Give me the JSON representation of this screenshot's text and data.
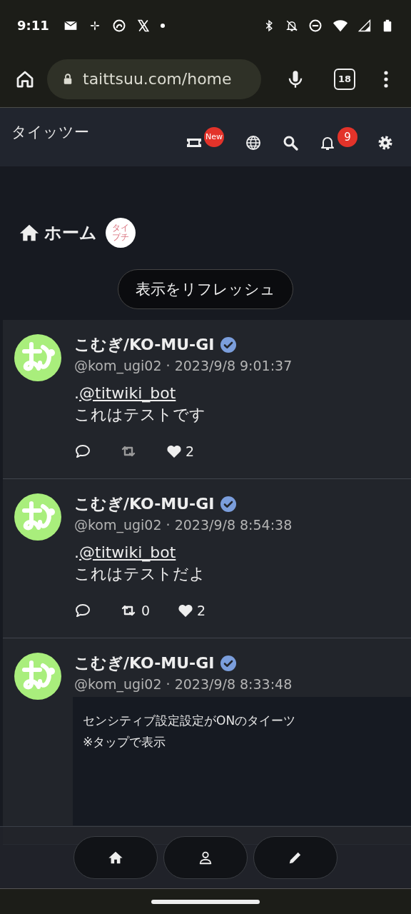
{
  "status_bar": {
    "time": "9:11"
  },
  "browser": {
    "url": "taittsuu.com/home",
    "tab_count": "18"
  },
  "header": {
    "title": "タイッツー",
    "actions": [
      {
        "kind": "ticket",
        "badge": "New"
      },
      {
        "kind": "globe"
      },
      {
        "kind": "search"
      },
      {
        "kind": "bell",
        "badge": "9"
      },
      {
        "kind": "settings"
      }
    ]
  },
  "heading": {
    "title": "ホーム",
    "logo": "タイプチ"
  },
  "refresh_button": "表示をリフレッシュ",
  "posts": [
    {
      "kind": "text",
      "name": "こむぎ/KO-MU-GI",
      "verified": true,
      "meta": "@kom_ugi02 · 2023/9/8 9:01:37",
      "prefix": ".",
      "mention": "@titwiki_bot",
      "text": "これはテストです",
      "retweet": {
        "disabled": true
      },
      "like": {
        "count": "2"
      }
    },
    {
      "kind": "text",
      "name": "こむぎ/KO-MU-GI",
      "verified": true,
      "meta": "@kom_ugi02 · 2023/9/8 8:54:38",
      "prefix": ".",
      "mention": "@titwiki_bot",
      "text": "これはテストだよ",
      "retweet": {
        "disabled": false,
        "count": "0"
      },
      "like": {
        "count": "2"
      }
    },
    {
      "kind": "sensitive",
      "name": "こむぎ/KO-MU-GI",
      "verified": true,
      "meta": "@kom_ugi02 · 2023/9/8 8:33:48",
      "notice": [
        "センシティブ設定設定がONのタイーツ",
        "※タップで表示"
      ]
    }
  ],
  "bottom_nav": [
    {
      "kind": "home"
    },
    {
      "kind": "profile"
    },
    {
      "kind": "compose"
    }
  ]
}
